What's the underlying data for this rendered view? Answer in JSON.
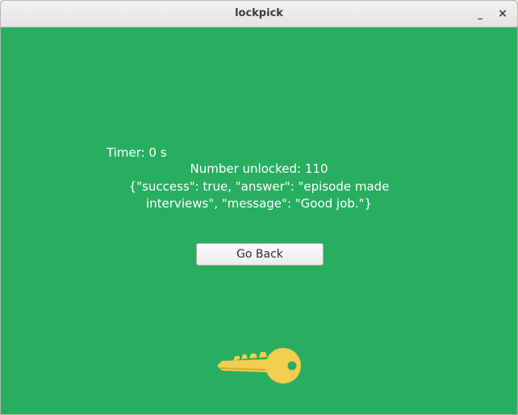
{
  "window": {
    "title": "lockpick",
    "minimize_label": "_",
    "close_label": "×"
  },
  "game": {
    "timer": "Timer: 0 s",
    "unlocked": "Number unlocked: 110",
    "message_line1": "{\"success\": true, \"answer\": \"episode made",
    "message_line2": "interviews\", \"message\": \"Good job.\"}",
    "go_back_label": "Go Back",
    "key_icon": "key-icon"
  },
  "colors": {
    "background": "#27ae60",
    "key": "#f5cd4f",
    "text": "#ffffff"
  }
}
